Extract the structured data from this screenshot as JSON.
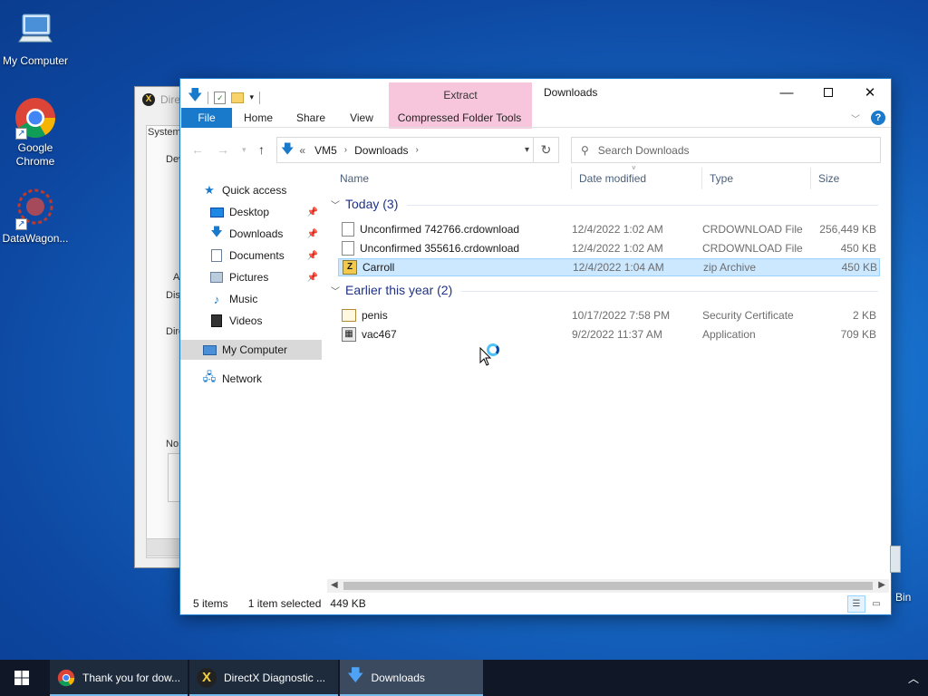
{
  "desktop": {
    "icons": [
      {
        "label": "My Computer"
      },
      {
        "label": "Google Chrome"
      },
      {
        "label": "DataWagon..."
      }
    ],
    "recycle_partial": "Bin"
  },
  "dx_window": {
    "title": "Dire",
    "tab": "System",
    "labels": [
      "Dev",
      "A",
      "Dis",
      "Dire",
      "No"
    ]
  },
  "explorer": {
    "title": "Downloads",
    "contextual_tab": "Extract",
    "ribbon_tabs": [
      "File",
      "Home",
      "Share",
      "View",
      "Compressed Folder Tools"
    ],
    "address": {
      "prefix": "«",
      "crumbs": [
        "VM5",
        "Downloads"
      ]
    },
    "search_placeholder": "Search Downloads",
    "nav": [
      {
        "label": "Quick access",
        "icon": "star-icon",
        "pinned": false
      },
      {
        "label": "Desktop",
        "icon": "desktop-icon",
        "pinned": true
      },
      {
        "label": "Downloads",
        "icon": "download-icon",
        "pinned": true
      },
      {
        "label": "Documents",
        "icon": "documents-icon",
        "pinned": true
      },
      {
        "label": "Pictures",
        "icon": "pictures-icon",
        "pinned": true
      },
      {
        "label": "Music",
        "icon": "music-icon",
        "pinned": false
      },
      {
        "label": "Videos",
        "icon": "videos-icon",
        "pinned": false
      },
      {
        "label": "My Computer",
        "icon": "computer-icon",
        "pinned": false,
        "selected": true
      },
      {
        "label": "Network",
        "icon": "network-icon",
        "pinned": false
      }
    ],
    "columns": [
      "Name",
      "Date modified",
      "Type",
      "Size"
    ],
    "groups": [
      {
        "title": "Today (3)",
        "files": [
          {
            "name": "Unconfirmed 742766.crdownload",
            "date": "12/4/2022 1:02 AM",
            "type": "CRDOWNLOAD File",
            "size": "256,449 KB",
            "icon": "file-icon"
          },
          {
            "name": "Unconfirmed 355616.crdownload",
            "date": "12/4/2022 1:02 AM",
            "type": "CRDOWNLOAD File",
            "size": "450 KB",
            "icon": "file-icon"
          },
          {
            "name": "Carroll",
            "date": "12/4/2022 1:04 AM",
            "type": "zip Archive",
            "size": "450 KB",
            "icon": "zip-icon",
            "selected": true
          }
        ]
      },
      {
        "title": "Earlier this year (2)",
        "files": [
          {
            "name": "penis",
            "date": "10/17/2022 7:58 PM",
            "type": "Security Certificate",
            "size": "2 KB",
            "icon": "certificate-icon"
          },
          {
            "name": "vac467",
            "date": "9/2/2022 11:37 AM",
            "type": "Application",
            "size": "709 KB",
            "icon": "application-icon"
          }
        ]
      }
    ],
    "status": {
      "items": "5 items",
      "selected": "1 item selected",
      "size": "449 KB"
    }
  },
  "taskbar": {
    "tasks": [
      {
        "label": "Thank you for dow...",
        "icon": "chrome-icon"
      },
      {
        "label": "DirectX Diagnostic ...",
        "icon": "directx-icon"
      },
      {
        "label": "Downloads",
        "icon": "download-icon"
      }
    ]
  },
  "colors": {
    "accent": "#1979ca",
    "selection": "#cce8ff",
    "extract_tab": "#f8c6dc",
    "taskbar": "#101828"
  }
}
